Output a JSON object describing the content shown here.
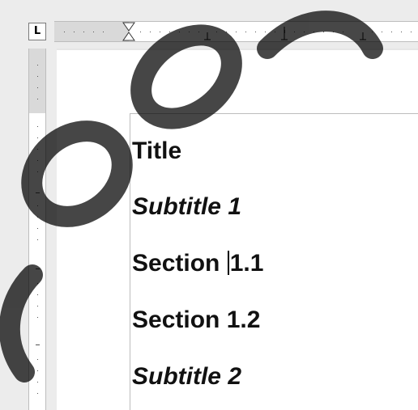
{
  "ruler": {
    "tab_selector_glyph": "L"
  },
  "document": {
    "paragraphs": [
      {
        "text": "Title",
        "style": "bold"
      },
      {
        "text": "Subtitle 1",
        "style": "bolditalic"
      },
      {
        "text_before_cursor": "Section ",
        "text_after_cursor": "1.1",
        "style": "plainbold"
      },
      {
        "text": "Section 1.2",
        "style": "plainbold"
      },
      {
        "text": "Subtitle 2",
        "style": "bolditalic"
      }
    ]
  },
  "watermark": {
    "color": "#000000"
  }
}
